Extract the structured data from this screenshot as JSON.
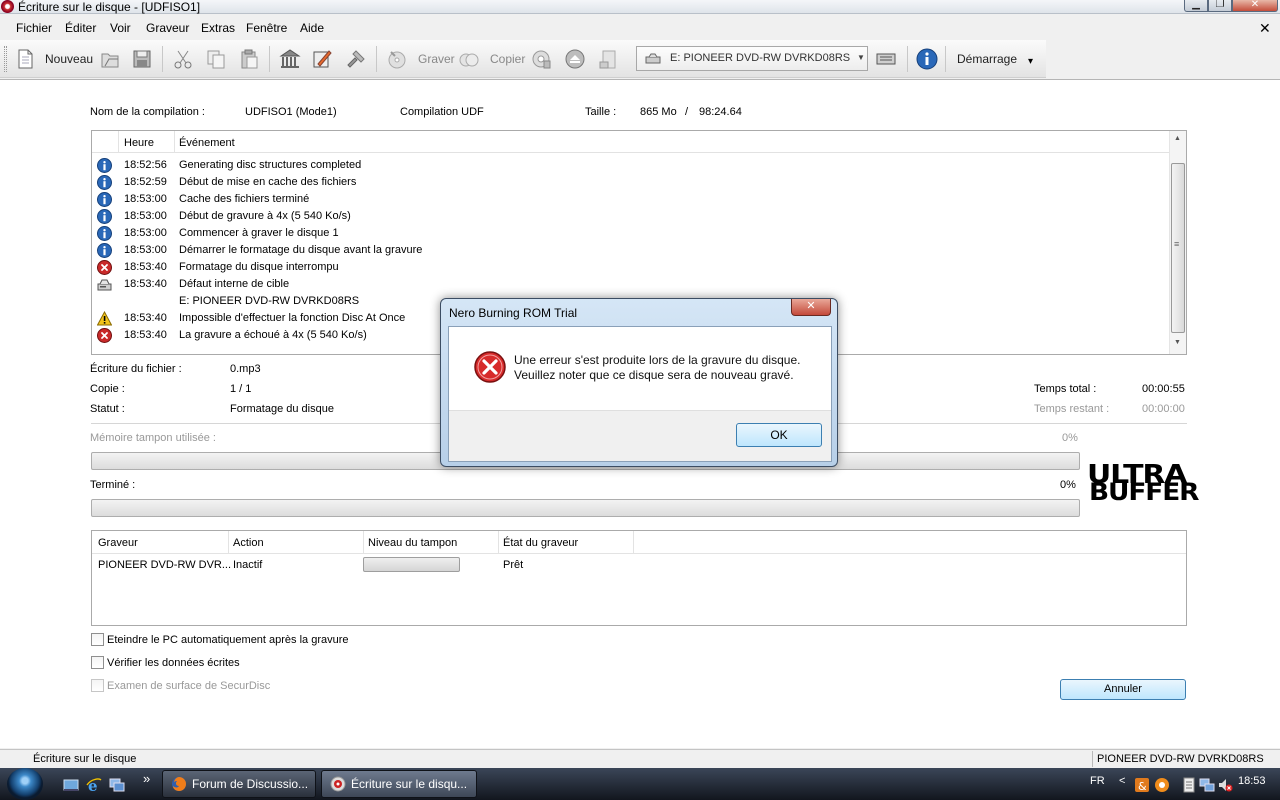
{
  "window": {
    "title": "Écriture sur le disque - [UDFISO1]",
    "minimize_glyph": "▁",
    "maximize_glyph": "❐",
    "close_glyph": "✕"
  },
  "menu": {
    "items": [
      "Fichier",
      "Éditer",
      "Voir",
      "Graveur",
      "Extras",
      "Fenêtre",
      "Aide"
    ],
    "mdi_close": "✕"
  },
  "toolbar": {
    "new_label": "Nouveau",
    "burn_label": "Graver",
    "copy_label": "Copier",
    "drive_value": "E: PIONEER DVD-RW DVRKD08RS",
    "start_label": "Démarrage",
    "overflow_glyph": "▾"
  },
  "compilation": {
    "name_label": "Nom de la compilation :",
    "name_value": "UDFISO1 (Mode1)",
    "type": "Compilation UDF",
    "size_label": "Taille :",
    "size_value": "865 Mo",
    "size_sep": "/",
    "duration": "98:24.64"
  },
  "log": {
    "col_time": "Heure",
    "col_event": "Événement",
    "rows": [
      {
        "icon": "info",
        "time": "18:52:56",
        "message": "Generating disc structures completed"
      },
      {
        "icon": "info",
        "time": "18:52:59",
        "message": "Début de mise en cache des fichiers"
      },
      {
        "icon": "info",
        "time": "18:53:00",
        "message": "Cache des fichiers terminé"
      },
      {
        "icon": "info",
        "time": "18:53:00",
        "message": "Début de gravure à 4x (5 540 Ko/s)"
      },
      {
        "icon": "info",
        "time": "18:53:00",
        "message": "Commencer à graver le disque 1"
      },
      {
        "icon": "info",
        "time": "18:53:00",
        "message": "Démarrer le formatage du disque avant la gravure"
      },
      {
        "icon": "error",
        "time": "18:53:40",
        "message": "Formatage du disque interrompu"
      },
      {
        "icon": "drive",
        "time": "18:53:40",
        "message": "Défaut interne de cible"
      },
      {
        "icon": "none",
        "time": "",
        "message": "E: PIONEER DVD-RW DVRKD08RS"
      },
      {
        "icon": "warning",
        "time": "18:53:40",
        "message": "Impossible d'effectuer la fonction Disc At Once"
      },
      {
        "icon": "error",
        "time": "18:53:40",
        "message": "La gravure a échoué à 4x (5 540 Ko/s)"
      }
    ]
  },
  "status": {
    "file_label": "Écriture du fichier :",
    "file_value": "0.mp3",
    "copy_label": "Copie :",
    "copy_value": "1 / 1",
    "status_label": "Statut :",
    "status_value": "Formatage du disque",
    "total_time_label": "Temps total :",
    "total_time_value": "00:00:55",
    "remaining_label": "Temps restant :",
    "remaining_value": "00:00:00",
    "buffer_label": "Mémoire tampon utilisée :",
    "buffer_percent_text": "0%",
    "buffer_fraction": 0,
    "done_label": "Terminé :",
    "done_percent_text": "0%",
    "done_fraction": 0
  },
  "logo": {
    "line1": "ULTRA",
    "line2": "BUFFER"
  },
  "recorders": {
    "col_recorder": "Graveur",
    "col_action": "Action",
    "col_buffer": "Niveau du tampon",
    "col_state": "État du graveur",
    "row": {
      "recorder": "PIONEER DVD-RW DVR...",
      "action": "Inactif",
      "state": "Prêt"
    }
  },
  "options": {
    "shutdown_label": "Eteindre le PC automatiquement après la gravure",
    "verify_label": "Vérifier les données écrites",
    "securdisc_label": "Examen de surface de SecurDisc"
  },
  "cancel_label": "Annuler",
  "statusbar": {
    "left": "Écriture sur le disque",
    "right": "PIONEER  DVD-RW DVRKD08RS"
  },
  "dialog": {
    "title": "Nero Burning ROM Trial",
    "close_glyph": "✕",
    "message_line1": "Une erreur s'est produite lors de la gravure du disque.",
    "message_line2": "Veuillez noter que ce disque sera de nouveau gravé.",
    "ok_label": "OK"
  },
  "taskbar": {
    "quicklaunch_more": "»",
    "task1": "Forum de Discussio...",
    "task2": "Écriture sur le disqu...",
    "language": "FR",
    "tray_arrow": "<",
    "clock": "18:53"
  }
}
